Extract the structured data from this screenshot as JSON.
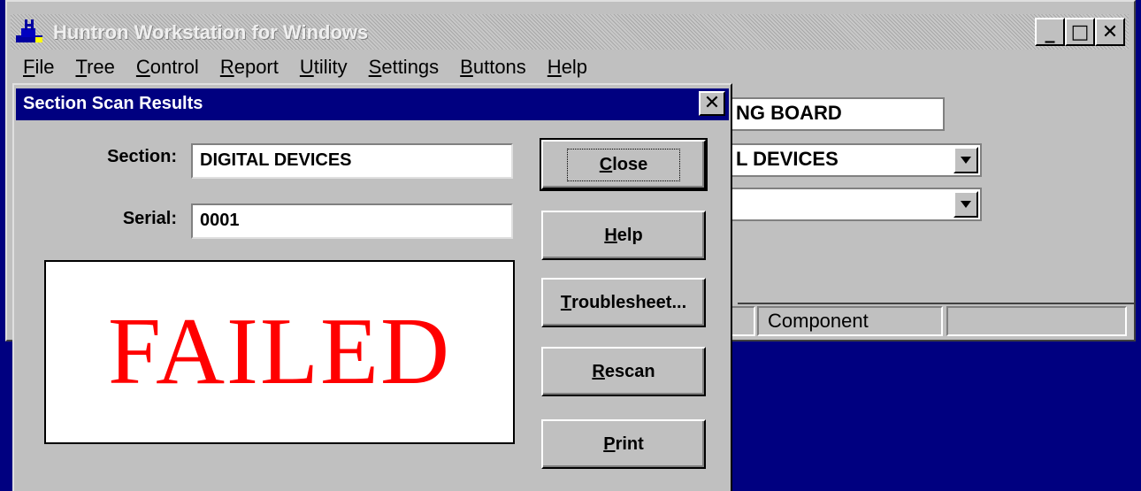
{
  "window": {
    "title": "Huntron Workstation for Windows",
    "buttons": {
      "minimize": "_",
      "maximize": "□",
      "close": "✕"
    }
  },
  "menubar": [
    {
      "mnemonic": "F",
      "rest": "ile"
    },
    {
      "mnemonic": "T",
      "rest": "ree"
    },
    {
      "mnemonic": "C",
      "rest": "ontrol"
    },
    {
      "mnemonic": "R",
      "rest": "eport"
    },
    {
      "mnemonic": "U",
      "rest": "tility"
    },
    {
      "mnemonic": "S",
      "rest": "ettings"
    },
    {
      "mnemonic": "B",
      "rest": "uttons"
    },
    {
      "mnemonic": "H",
      "rest": "elp"
    }
  ],
  "background": {
    "board_field": "NG BOARD",
    "section_combo": "L DEVICES",
    "third_combo": "",
    "status": {
      "left": "",
      "component": "Component",
      "right": ""
    }
  },
  "dialog": {
    "title": "Section Scan Results",
    "close_glyph": "✕",
    "section_label": "Section:",
    "section_value": "DIGITAL DEVICES",
    "serial_label": "Serial:",
    "serial_value": "0001",
    "result": "FAILED",
    "result_color": "#ff0000",
    "buttons": {
      "close": {
        "mnemonic": "C",
        "rest": "lose"
      },
      "help": {
        "mnemonic": "H",
        "rest": "elp"
      },
      "troubleshoot": {
        "mnemonic": "T",
        "rest": "roublesheet..."
      },
      "rescan": {
        "mnemonic": "R",
        "rest": "escan"
      },
      "print": {
        "mnemonic": "P",
        "rest": "rint"
      }
    }
  },
  "colors": {
    "desktop": "#000080",
    "title_active": "#000080",
    "face": "#c0c0c0"
  }
}
